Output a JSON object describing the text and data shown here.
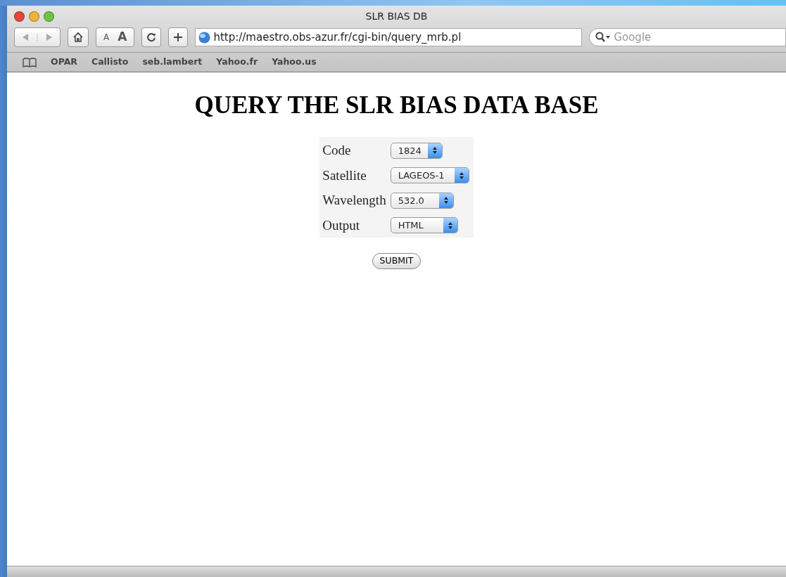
{
  "window": {
    "title": "SLR BIAS DB"
  },
  "toolbar": {
    "text_size": [
      "A",
      "A"
    ],
    "address": "http://maestro.obs-azur.fr/cgi-bin/query_mrb.pl",
    "search": {
      "placeholder": "Google"
    }
  },
  "bookmarks": [
    "OPAR",
    "Callisto",
    "seb.lambert",
    "Yahoo.fr",
    "Yahoo.us"
  ],
  "page": {
    "heading": "QUERY THE SLR BIAS DATA BASE",
    "fields": [
      {
        "label": "Code",
        "value": "1824"
      },
      {
        "label": "Satellite",
        "value": "LAGEOS-1"
      },
      {
        "label": "Wavelength",
        "value": "532.0"
      },
      {
        "label": "Output",
        "value": "HTML"
      }
    ],
    "submit": "SUBMIT"
  }
}
